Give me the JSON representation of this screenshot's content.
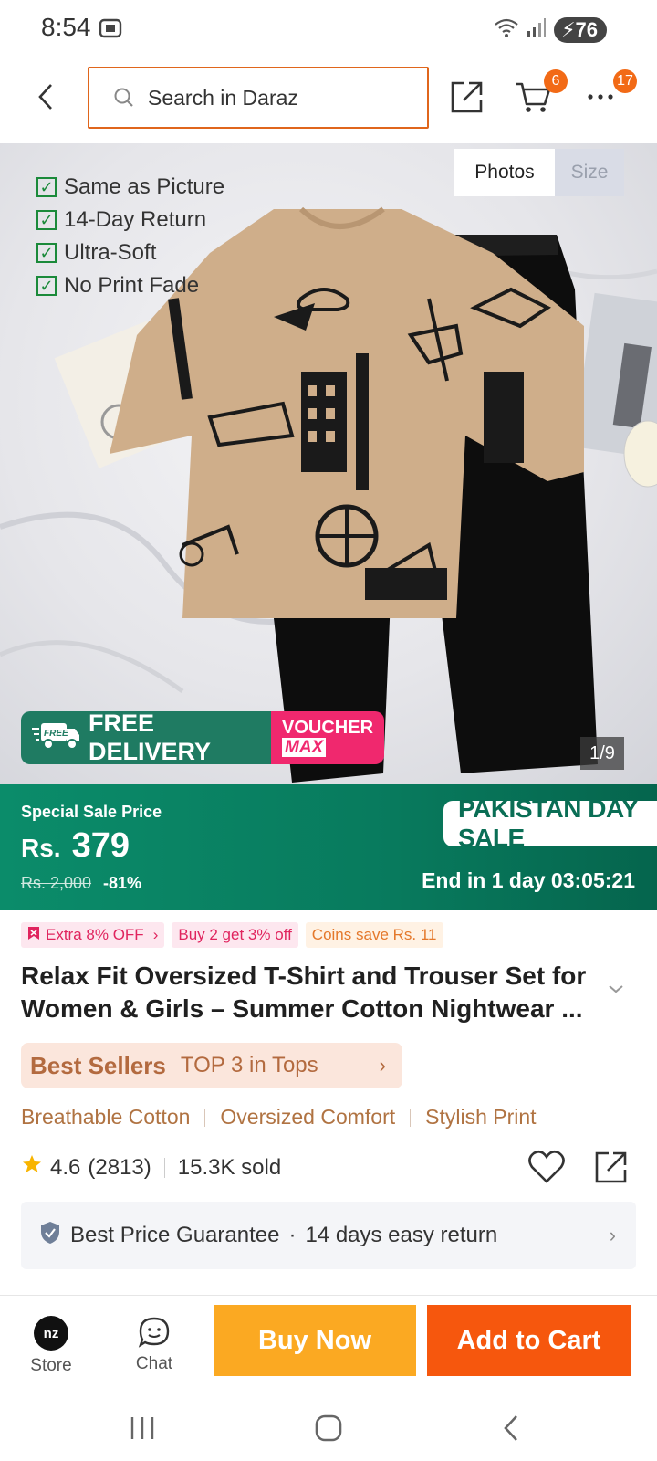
{
  "status_bar": {
    "time": "8:54",
    "battery": "76"
  },
  "header": {
    "search_placeholder": "Search in Daraz",
    "cart_badge": "6",
    "more_badge": "17"
  },
  "gallery": {
    "tabs": [
      "Photos",
      "Size"
    ],
    "active_tab": "Photos",
    "highlights": [
      "Same as Picture",
      "14-Day Return",
      "Ultra-Soft",
      "No Print Fade"
    ],
    "free_delivery_label": "FREE DELIVERY",
    "free_icon_label": "FREE",
    "voucher_top": "VOUCHER",
    "voucher_bottom": "MAX",
    "counter": "1/9"
  },
  "price": {
    "sale_label": "Special Sale Price",
    "currency": "Rs.",
    "value": "379",
    "original": "Rs. 2,000",
    "discount": "-81%",
    "event_tag": "PAKISTAN DAY SALE",
    "countdown": "End in 1 day 03:05:21"
  },
  "chips": {
    "extra": "Extra 8% OFF",
    "buy2": "Buy 2 get 3% off",
    "coins": "Coins save Rs. 11"
  },
  "product": {
    "title": "Relax Fit Oversized T-Shirt and Trouser Set for Women & Girls – Summer Cotton Nightwear ..."
  },
  "best_sellers": {
    "title": "Best Sellers",
    "rank": "TOP 3 in Tops"
  },
  "features": [
    "Breathable Cotton",
    "Oversized Comfort",
    "Stylish Print"
  ],
  "rating": {
    "score": "4.6",
    "count": "(2813)",
    "sold": "15.3K sold"
  },
  "guarantee": {
    "best_price": "Best Price Guarantee",
    "dot": "·",
    "returns": "14 days easy return"
  },
  "bottom_bar": {
    "store_label": "Store",
    "store_logo": "nz",
    "chat_label": "Chat",
    "buy_now": "Buy Now",
    "add_to_cart": "Add to Cart"
  },
  "colors": {
    "accent_orange": "#f6570d",
    "buy_now_yellow": "#fba922",
    "sale_green": "#0b8c6a",
    "search_border": "#e0661c"
  }
}
